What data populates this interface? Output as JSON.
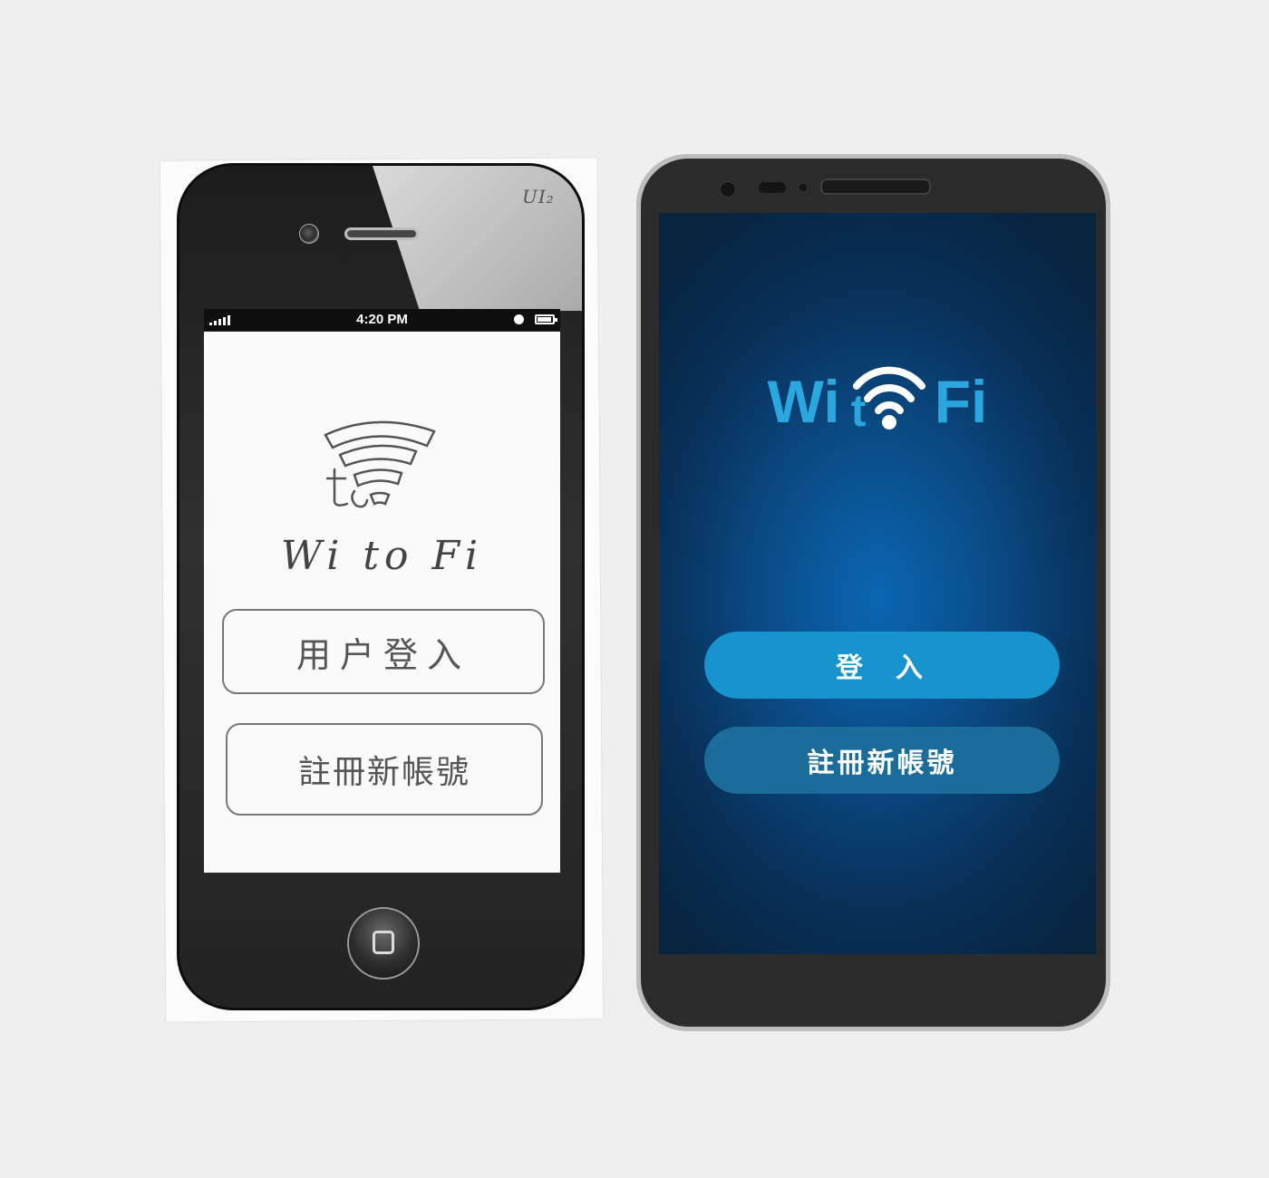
{
  "sketch_phone": {
    "corner_tag": "UI₂",
    "status_time": "4:20 PM",
    "app_title": "Wi to Fi",
    "login_label": "用户登入",
    "register_label": "註冊新帳號"
  },
  "android_phone": {
    "logo": {
      "left": "Wi",
      "middle": "t",
      "right": "Fi"
    },
    "login_label": "登入",
    "register_label": "註冊新帳號"
  },
  "colors": {
    "accent": "#2aa7df",
    "login_button": "#1793cd",
    "register_button": "#1c6c9a",
    "screen_center": "#0b66b2",
    "screen_edge": "#07243f"
  },
  "icons": [
    "wifi-icon",
    "home-button-icon",
    "battery-icon",
    "signal-icon",
    "clock-icon"
  ]
}
